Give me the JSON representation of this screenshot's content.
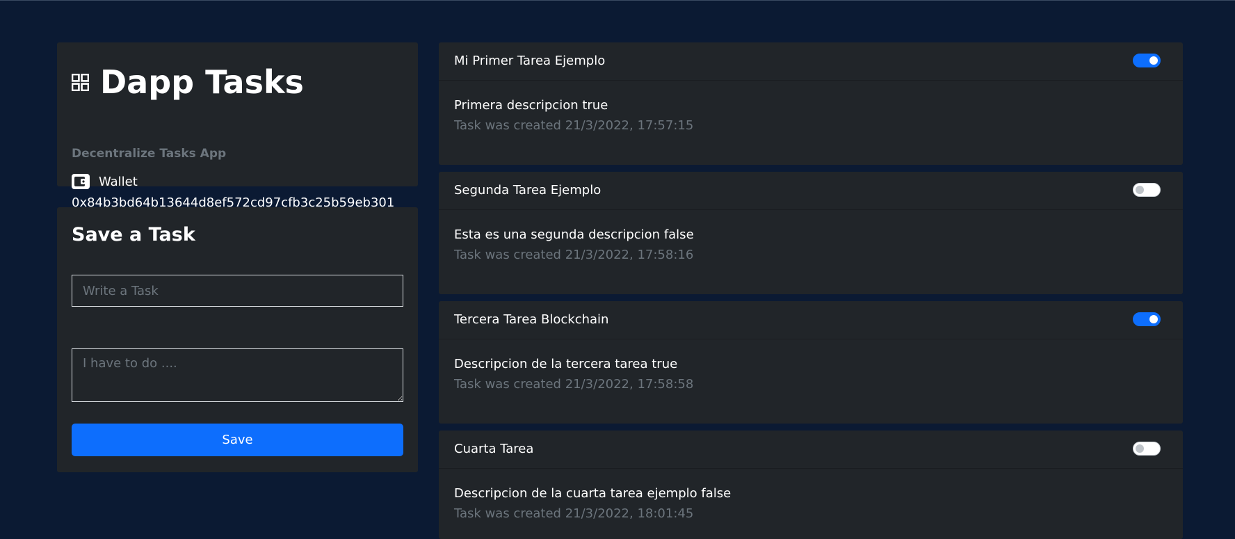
{
  "app": {
    "title": "Dapp Tasks",
    "subtitle": "Decentralize Tasks App",
    "wallet_label": "Wallet",
    "wallet_address": "0x84b3bd64b13644d8ef572cd97cfb3c25b59eb301",
    "icons": {
      "logo": "grid-icon",
      "wallet": "wallet-icon"
    }
  },
  "form": {
    "title": "Save a Task",
    "task_placeholder": "Write a Task",
    "description_placeholder": "I have to do ....",
    "save_label": "Save"
  },
  "colors": {
    "background": "#0b1a33",
    "card": "#212529",
    "accent": "#0d6efd",
    "muted": "#6c757d"
  },
  "tasks": [
    {
      "title": "Mi Primer Tarea Ejemplo",
      "description": "Primera descripcion true",
      "created": "Task was created 21/3/2022, 17:57:15",
      "done": true
    },
    {
      "title": "Segunda Tarea Ejemplo",
      "description": "Esta es una segunda descripcion false",
      "created": "Task was created 21/3/2022, 17:58:16",
      "done": false
    },
    {
      "title": "Tercera Tarea Blockchain",
      "description": "Descripcion de la tercera tarea true",
      "created": "Task was created 21/3/2022, 17:58:58",
      "done": true
    },
    {
      "title": "Cuarta Tarea",
      "description": "Descripcion de la cuarta tarea ejemplo false",
      "created": "Task was created 21/3/2022, 18:01:45",
      "done": false
    }
  ]
}
